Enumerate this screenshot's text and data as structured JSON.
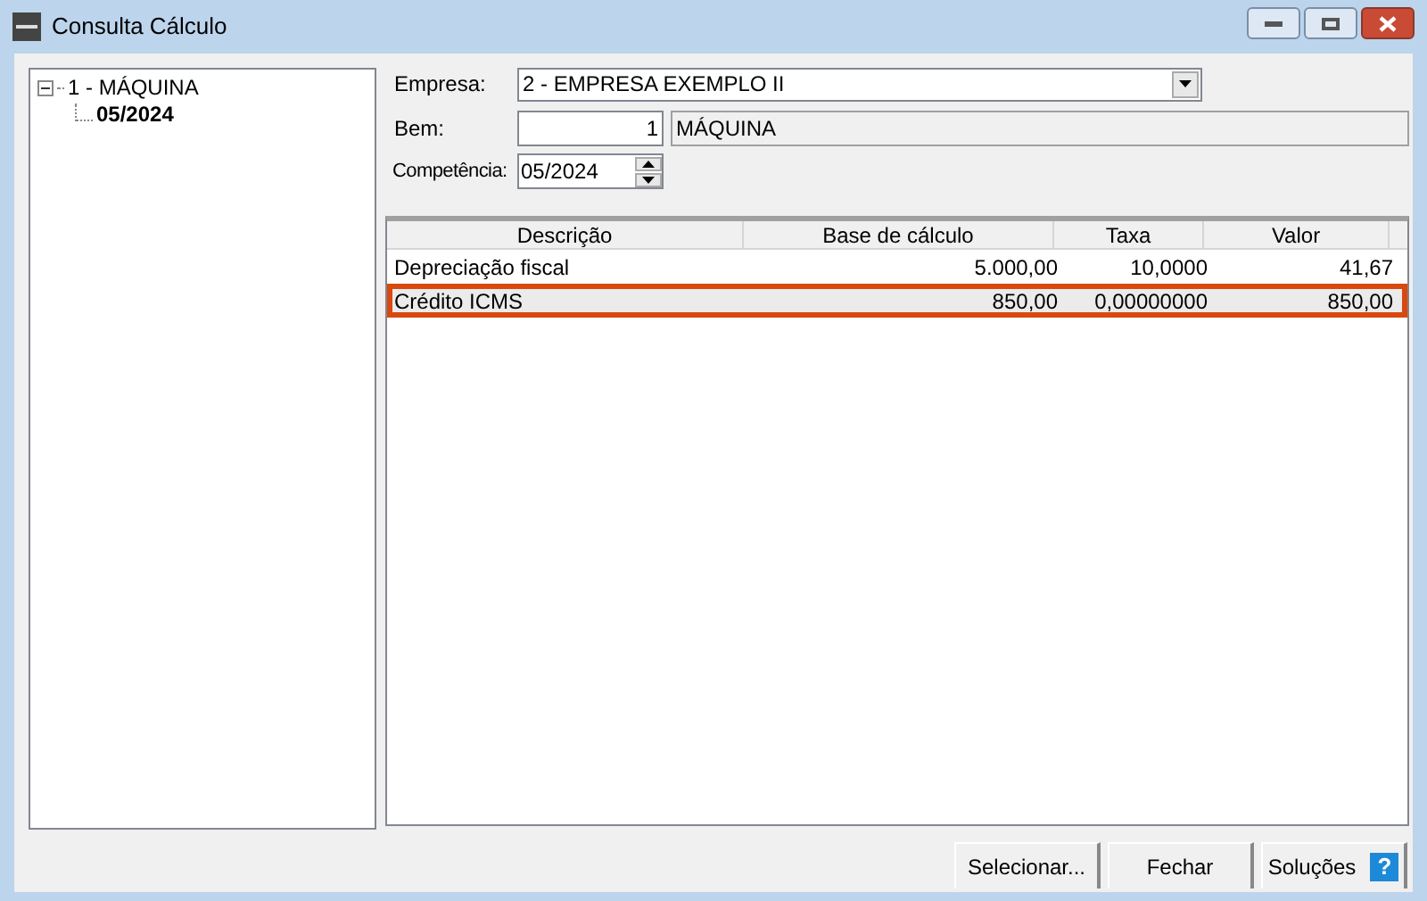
{
  "window": {
    "title": "Consulta Cálculo"
  },
  "tree": [
    {
      "label": "1 - MÁQUINA",
      "expanded": true,
      "children": [
        {
          "label": "05/2024",
          "selected": true
        }
      ]
    }
  ],
  "form": {
    "empresa": {
      "label": "Empresa:",
      "value": "2 - EMPRESA EXEMPLO II"
    },
    "bem": {
      "label": "Bem:",
      "code": "1",
      "name": "MÁQUINA"
    },
    "competencia": {
      "label": "Competência:",
      "value": "05/2024"
    }
  },
  "table": {
    "columns": [
      "Descrição",
      "Base de cálculo",
      "Taxa",
      "Valor"
    ],
    "rows": [
      {
        "cells": [
          "Depreciação fiscal",
          "5.000,00",
          "10,0000",
          "41,67"
        ],
        "selected": false
      },
      {
        "cells": [
          "Crédito ICMS",
          "850,00",
          "0,00000000",
          "850,00"
        ],
        "selected": true
      }
    ]
  },
  "buttons": [
    {
      "label": "Selecionar...",
      "kind": "plain"
    },
    {
      "label": "Fechar",
      "kind": "plain"
    },
    {
      "label": "Soluções",
      "kind": "help",
      "icon_text": "?"
    }
  ]
}
